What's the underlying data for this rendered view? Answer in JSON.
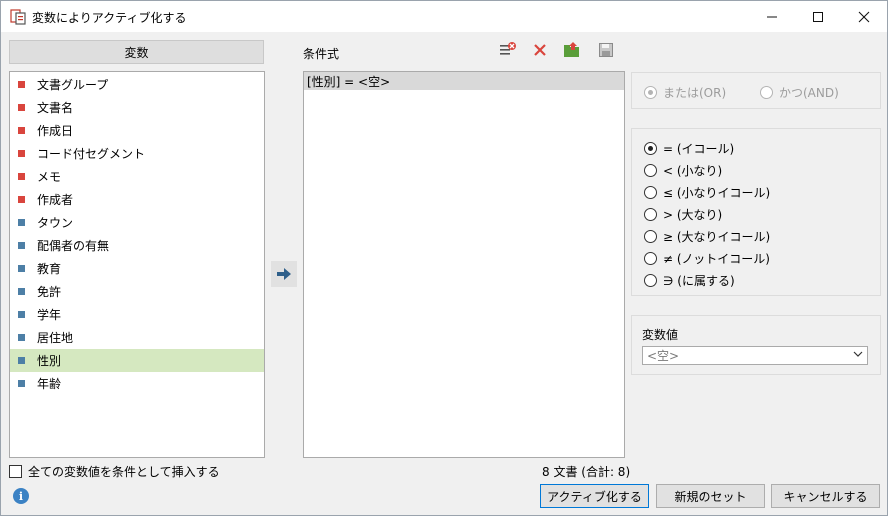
{
  "window": {
    "title": "変数によりアクティブ化する",
    "minimize_glyph": "—",
    "maximize_glyph": "☐",
    "close_glyph": "✕"
  },
  "variables": {
    "header": "変数",
    "items": [
      {
        "label": "文書グループ",
        "color": "#d9453d"
      },
      {
        "label": "文書名",
        "color": "#d9453d"
      },
      {
        "label": "作成日",
        "color": "#d9453d"
      },
      {
        "label": "コード付セグメント",
        "color": "#d9453d"
      },
      {
        "label": "メモ",
        "color": "#d9453d"
      },
      {
        "label": "作成者",
        "color": "#d9453d"
      },
      {
        "label": "タウン",
        "color": "#4d7fa6"
      },
      {
        "label": "配偶者の有無",
        "color": "#4d7fa6"
      },
      {
        "label": "教育",
        "color": "#4d7fa6"
      },
      {
        "label": "免許",
        "color": "#4d7fa6"
      },
      {
        "label": "学年",
        "color": "#4d7fa6"
      },
      {
        "label": "居住地",
        "color": "#4d7fa6"
      },
      {
        "label": "性別",
        "color": "#4d7fa6",
        "selected": true
      },
      {
        "label": "年齢",
        "color": "#4d7fa6"
      }
    ]
  },
  "conditions": {
    "label": "条件式",
    "items": [
      "[性別] = <空>"
    ],
    "toolbar_icons": [
      "clear-conditions-icon",
      "delete-icon",
      "export-icon",
      "save-icon"
    ]
  },
  "logic": {
    "or_label": "または(OR)",
    "and_label": "かつ(AND)",
    "selected": "or",
    "enabled": false
  },
  "operators": {
    "items": [
      {
        "label": "= (イコール)",
        "checked": true
      },
      {
        "label": "< (小なり)",
        "checked": false
      },
      {
        "label": "≤ (小なりイコール)",
        "checked": false
      },
      {
        "label": "> (大なり)",
        "checked": false
      },
      {
        "label": "≥ (大なりイコール)",
        "checked": false
      },
      {
        "label": "≠ (ノットイコール)",
        "checked": false
      },
      {
        "label": "∋ (に属する)",
        "checked": false
      }
    ]
  },
  "value": {
    "label": "変数値",
    "selected": "<空>"
  },
  "footer": {
    "insert_all_label": "全ての変数値を条件として挿入する",
    "insert_all_checked": false,
    "doc_count": "8 文書 (合計: 8)",
    "activate_button": "アクティブ化する",
    "new_set_button": "新規のセット",
    "cancel_button": "キャンセルする"
  },
  "colors": {
    "doc_var": "#d9453d",
    "user_var": "#4d7fa6",
    "selection": "#d5e8c0",
    "accent": "#0078d7"
  }
}
